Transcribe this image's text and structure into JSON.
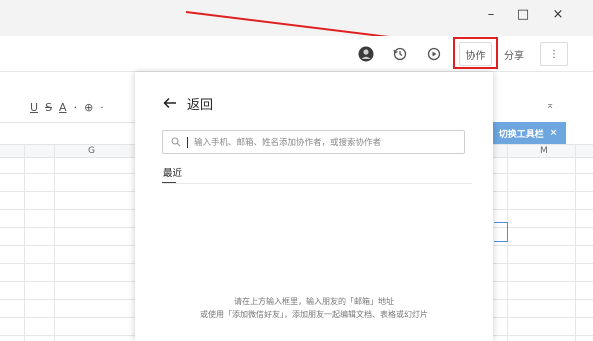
{
  "window": {
    "minimize": "–",
    "maximize": "□",
    "close": "×"
  },
  "toolbar": {
    "collaborate_label": "协作",
    "share_label": "分享",
    "more_label": "⋮",
    "icons": [
      "avatar",
      "history-icon",
      "present-icon"
    ]
  },
  "format_bar": {
    "items": [
      "U",
      "S",
      "A",
      "·",
      "⊕",
      "·"
    ]
  },
  "sheet": {
    "column_headers": [
      "G",
      "M"
    ],
    "collapse_glyph": "⌅"
  },
  "tip": {
    "label": "切换工具栏",
    "close": "×"
  },
  "panel": {
    "back_label": "返回",
    "search_placeholder": "输入手机、邮箱、姓名添加协作者，或搜索协作者",
    "recent_label": "最近",
    "empty_line1": "请在上方输入框里，输入朋友的「邮箱」地址",
    "empty_line2": "或使用「添加微信好友」，添加朋友一起编辑文档、表格或幻灯片"
  },
  "colors": {
    "annotation": "#e02020",
    "tip_bg": "#6ea6e0"
  }
}
